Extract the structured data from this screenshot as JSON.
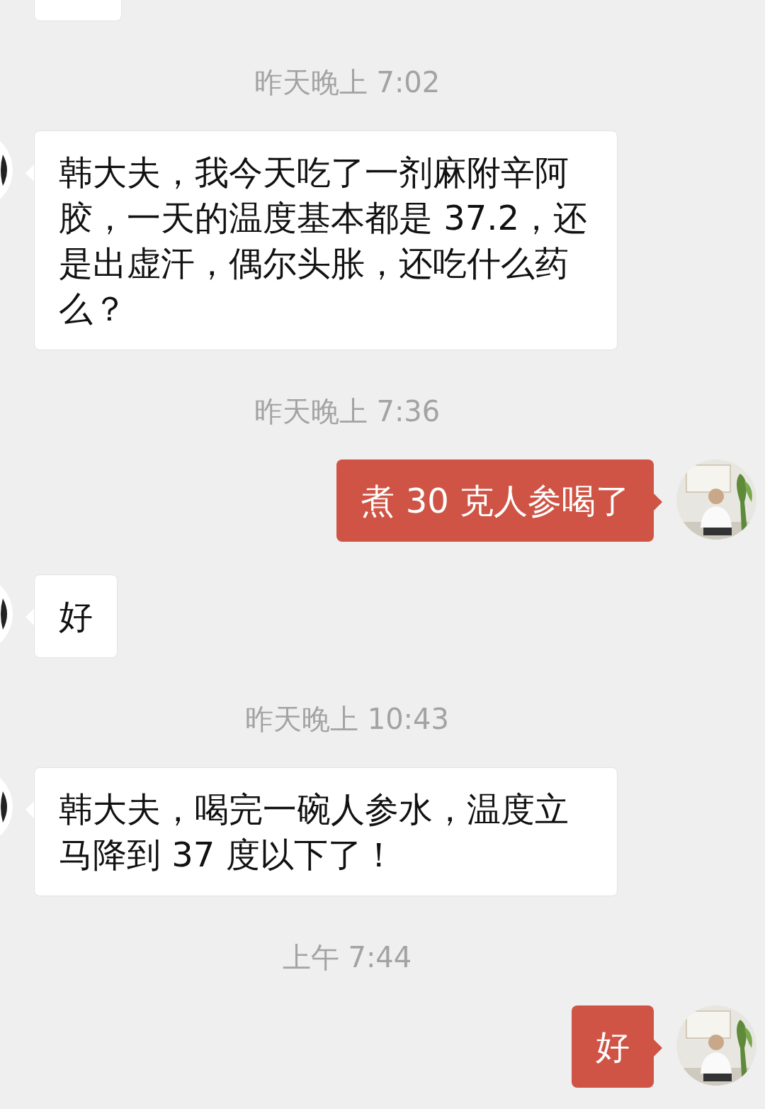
{
  "items": [
    {
      "kind": "left_cut_bubble"
    },
    {
      "kind": "time",
      "text": "昨天晚上 7:02"
    },
    {
      "kind": "left_message",
      "text": "韩大夫，我今天吃了一剂麻附辛阿胶，一天的温度基本都是 37.2，还是出虚汗，偶尔头胀，还吃什么药么？"
    },
    {
      "kind": "time",
      "text": "昨天晚上 7:36"
    },
    {
      "kind": "right_message",
      "text": "煮 30 克人参喝了"
    },
    {
      "kind": "left_message",
      "text": "好"
    },
    {
      "kind": "time",
      "text": "昨天晚上 10:43"
    },
    {
      "kind": "left_message",
      "text": "韩大夫，喝完一碗人参水，温度立马降到 37 度以下了！"
    },
    {
      "kind": "time",
      "text": "上午 7:44"
    },
    {
      "kind": "right_message",
      "text": "好"
    }
  ]
}
